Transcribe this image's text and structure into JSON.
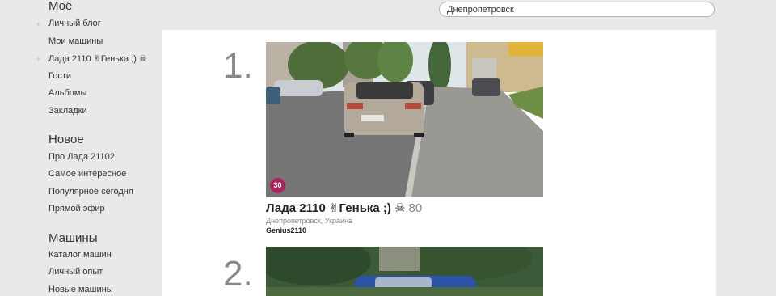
{
  "sidebar": {
    "mine": {
      "title": "Моё",
      "items": [
        {
          "label": "Личный блог",
          "plus": "+"
        },
        {
          "label": "Мои машины"
        },
        {
          "label": "Лада 2110 ✌Генька ;) ☠",
          "plus": "+"
        },
        {
          "label": "Гости"
        },
        {
          "label": "Альбомы"
        },
        {
          "label": "Закладки"
        }
      ]
    },
    "new": {
      "title": "Новое",
      "items": [
        {
          "label": "Про Лада 21102"
        },
        {
          "label": "Самое интересное"
        },
        {
          "label": "Популярное сегодня"
        },
        {
          "label": "Прямой эфир"
        }
      ]
    },
    "cars": {
      "title": "Машины",
      "items": [
        {
          "label": "Каталог машин"
        },
        {
          "label": "Личный опыт"
        },
        {
          "label": "Новые машины"
        }
      ]
    }
  },
  "search": {
    "value": "Днепропетровск"
  },
  "results": [
    {
      "rank": "1.",
      "badge": "30",
      "title": "Лада 2110 ✌Генька ;) ☠",
      "count": "80",
      "location": "Днепропетровск, Украина",
      "owner": "Genius2110"
    },
    {
      "rank": "2."
    }
  ],
  "colors": {
    "badge": "#a8255d",
    "page_bg": "#e9e9e9",
    "panel_bg": "#ffffff"
  }
}
